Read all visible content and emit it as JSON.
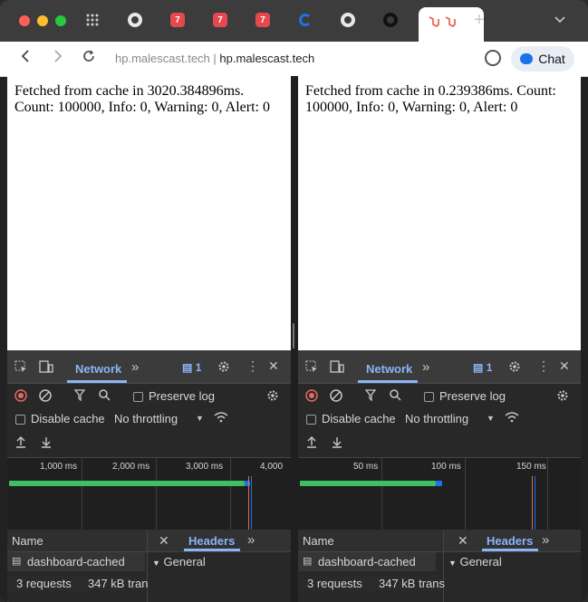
{
  "browser": {
    "url_origin": "hp.malescast.tech",
    "url_sep": "|",
    "url_host": "hp.malescast.tech",
    "chat_label": "Chat",
    "new_tab": "+",
    "tab_menu": "⌄",
    "icons": [
      "grid-icon",
      "github-icon",
      "laravel-7-icon",
      "laravel-7-icon",
      "laravel-7-icon",
      "cloud-ring-icon",
      "github-icon",
      "github-icon",
      "laravel-icon"
    ]
  },
  "left": {
    "message": "Fetched from cache in 3020.384896ms. Count: 100000, Info: 0, Warning: 0, Alert: 0",
    "timeline": {
      "ticks": [
        "1,000 ms",
        "2,000 ms",
        "3,000 ms",
        "4,000"
      ]
    },
    "request_name": "dashboard-cached",
    "status_text": "3 requests",
    "transfer_text": "347 kB tran"
  },
  "right": {
    "message": "Fetched from cache in 0.239386ms. Count: 100000, Info: 0, Warning: 0, Alert: 0",
    "timeline": {
      "ticks": [
        "50 ms",
        "100 ms",
        "150 ms"
      ]
    },
    "request_name": "dashboard-cached",
    "status_text": "3 requests",
    "transfer_text": "347 kB trans"
  },
  "devtools": {
    "network_tab": "Network",
    "issues_count": "1",
    "preserve_log": "Preserve log",
    "disable_cache": "Disable cache",
    "throttling": "No throttling",
    "name_col": "Name",
    "headers_tab": "Headers",
    "general": "General",
    "more": "»"
  },
  "colors": {
    "accent": "#8ab4f8",
    "record": "#e46962",
    "bar_green": "#3fbf60",
    "bar_blue": "#1a73e8"
  }
}
